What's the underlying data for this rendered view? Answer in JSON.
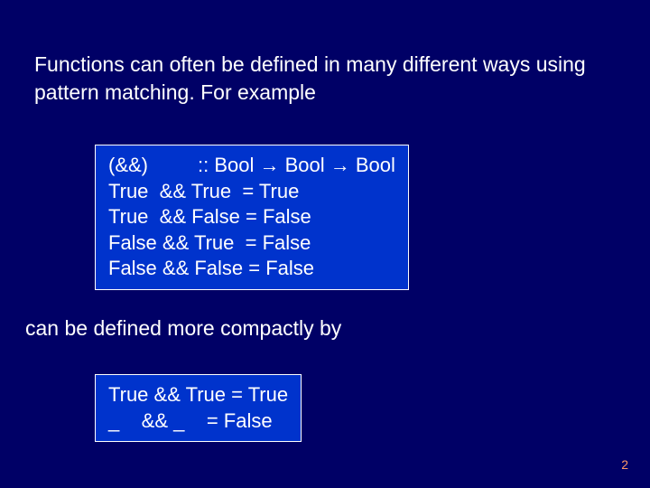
{
  "intro": "Functions can often be defined in many different ways using pattern matching.  For example",
  "codeBlock1": {
    "line1": "(&&)         :: Bool → Bool → Bool",
    "line2": "True  && True  = True",
    "line3": "True  && False = False",
    "line4": "False && True  = False",
    "line5": "False && False = False"
  },
  "midText": "can be defined more compactly by",
  "codeBlock2": {
    "line1": "True && True = True",
    "line2": "_    && _    = False"
  },
  "pageNumber": "2"
}
